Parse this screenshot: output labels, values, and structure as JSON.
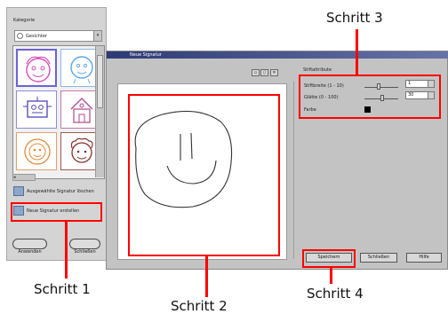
{
  "left_panel": {
    "category_label": "Kategorie",
    "category_value": "Gesichter",
    "actions": [
      {
        "label": "Ausgewählte Signatur löschen"
      },
      {
        "label": "Neue Signatur erstellen"
      }
    ],
    "buttons": {
      "apply": "Anwenden",
      "close": "Schließen"
    },
    "scroll_left": "◂"
  },
  "dialog": {
    "title": "Neue Signatur",
    "toolbar": [
      "▫",
      "▯",
      "✕"
    ],
    "settings": {
      "heading": "Stiftattribute",
      "width_label": "Stiftbreite (1 - 10)",
      "width_value": "1",
      "smoothness_label": "Glätte (0 - 100)",
      "smoothness_value": "30",
      "color_label": "Farbe"
    },
    "buttons": {
      "save": "Speichern",
      "close": "Schließen",
      "help": "Hilfe"
    }
  },
  "annotations": {
    "step1": "Schritt 1",
    "step2": "Schritt 2",
    "step3": "Schritt 3",
    "step4": "Schritt 4"
  },
  "colors": {
    "annotation_red": "#ff0000",
    "title_bar": "#2d3b74",
    "dialog_bg": "#c3c3c3"
  }
}
